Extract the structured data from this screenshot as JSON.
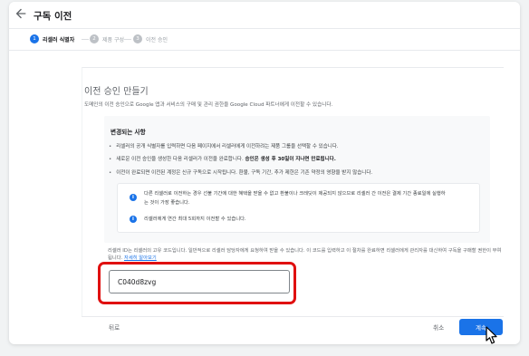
{
  "header": {
    "title": "구독 이전"
  },
  "stepper": {
    "steps": [
      {
        "num": "1",
        "label": "리셀러 식별자"
      },
      {
        "num": "2",
        "label": "제품 구성"
      },
      {
        "num": "3",
        "label": "이전 승인"
      }
    ],
    "active_index": 0
  },
  "section": {
    "title": "이전 승인 만들기",
    "description": "도메인의 이전 승인으로 Google 앱과 서비스의 구매 및 관리 권한을 Google Cloud 파트너에게 이전할 수 있습니다."
  },
  "changes": {
    "title": "변경되는 사항",
    "bullets": [
      {
        "text": "리셀러의 공개 식별자를 입력하면 다음 페이지에서 리셀러에게 이전하려는 제품 그룹을 선택할 수 있습니다."
      },
      {
        "text_before": "새로운 이전 승인을 생성한 다음 리셀러가 이전을 완료합니다. ",
        "text_strong": "승인은 생성 후 30일이 지나면 만료됩니다."
      },
      {
        "text": "이전이 완료되면 이전된 계정은 신규 구독으로 시작됩니다. 환불, 구독 기간, 추가 제한은 기존 약정의 영향을 받지 않습니다."
      }
    ]
  },
  "info": {
    "line1": "다른 리셀러로 이전하는 경우 선불 기간에 대한 혜택을 받을 수 없고 환불이나 크레딧이 제공되지 않으므로 리셀러 간 이전은 결제 기간 종료일에 실행하",
    "line2": "는 것이 가장 좋습니다.",
    "line3": "리셀러에게 연간 최대 5회까지 이전할 수 있습니다."
  },
  "reseller_id": {
    "help": "리셀러 ID는 리셀러의 고유 코드입니다. 일반적으로 리셀러 담당자에게 요청하여 받을 수 있습니다. 이 코드를 입력하고 이 절차를 완료하면 리셀러에게 관리자를 대신하여 구독을 구매할 권한이 부여됩니다.",
    "link": "자세히 알아보기",
    "value": "C040d8zvg"
  },
  "footer": {
    "prev_label": "뒤로",
    "cancel_label": "취소",
    "continue_label": "계속"
  },
  "colors": {
    "accent": "#1a73e8",
    "highlight": "#e01010"
  },
  "icons": {
    "back": "arrow-back-icon",
    "info": "info-icon",
    "cursor": "mouse-pointer-icon"
  }
}
